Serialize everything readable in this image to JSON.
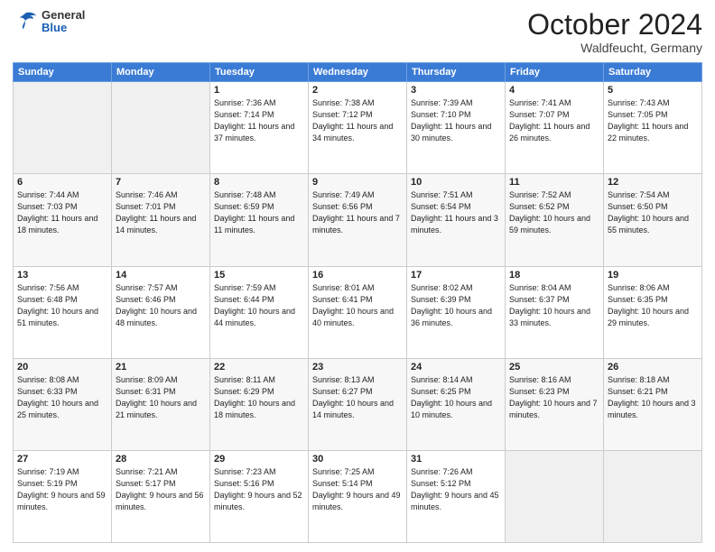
{
  "header": {
    "logo_general": "General",
    "logo_blue": "Blue",
    "title": "October 2024",
    "location": "Waldfeucht, Germany"
  },
  "days_of_week": [
    "Sunday",
    "Monday",
    "Tuesday",
    "Wednesday",
    "Thursday",
    "Friday",
    "Saturday"
  ],
  "weeks": [
    {
      "days": [
        {
          "num": "",
          "info": ""
        },
        {
          "num": "",
          "info": ""
        },
        {
          "num": "1",
          "info": "Sunrise: 7:36 AM\nSunset: 7:14 PM\nDaylight: 11 hours and 37 minutes."
        },
        {
          "num": "2",
          "info": "Sunrise: 7:38 AM\nSunset: 7:12 PM\nDaylight: 11 hours and 34 minutes."
        },
        {
          "num": "3",
          "info": "Sunrise: 7:39 AM\nSunset: 7:10 PM\nDaylight: 11 hours and 30 minutes."
        },
        {
          "num": "4",
          "info": "Sunrise: 7:41 AM\nSunset: 7:07 PM\nDaylight: 11 hours and 26 minutes."
        },
        {
          "num": "5",
          "info": "Sunrise: 7:43 AM\nSunset: 7:05 PM\nDaylight: 11 hours and 22 minutes."
        }
      ]
    },
    {
      "days": [
        {
          "num": "6",
          "info": "Sunrise: 7:44 AM\nSunset: 7:03 PM\nDaylight: 11 hours and 18 minutes."
        },
        {
          "num": "7",
          "info": "Sunrise: 7:46 AM\nSunset: 7:01 PM\nDaylight: 11 hours and 14 minutes."
        },
        {
          "num": "8",
          "info": "Sunrise: 7:48 AM\nSunset: 6:59 PM\nDaylight: 11 hours and 11 minutes."
        },
        {
          "num": "9",
          "info": "Sunrise: 7:49 AM\nSunset: 6:56 PM\nDaylight: 11 hours and 7 minutes."
        },
        {
          "num": "10",
          "info": "Sunrise: 7:51 AM\nSunset: 6:54 PM\nDaylight: 11 hours and 3 minutes."
        },
        {
          "num": "11",
          "info": "Sunrise: 7:52 AM\nSunset: 6:52 PM\nDaylight: 10 hours and 59 minutes."
        },
        {
          "num": "12",
          "info": "Sunrise: 7:54 AM\nSunset: 6:50 PM\nDaylight: 10 hours and 55 minutes."
        }
      ]
    },
    {
      "days": [
        {
          "num": "13",
          "info": "Sunrise: 7:56 AM\nSunset: 6:48 PM\nDaylight: 10 hours and 51 minutes."
        },
        {
          "num": "14",
          "info": "Sunrise: 7:57 AM\nSunset: 6:46 PM\nDaylight: 10 hours and 48 minutes."
        },
        {
          "num": "15",
          "info": "Sunrise: 7:59 AM\nSunset: 6:44 PM\nDaylight: 10 hours and 44 minutes."
        },
        {
          "num": "16",
          "info": "Sunrise: 8:01 AM\nSunset: 6:41 PM\nDaylight: 10 hours and 40 minutes."
        },
        {
          "num": "17",
          "info": "Sunrise: 8:02 AM\nSunset: 6:39 PM\nDaylight: 10 hours and 36 minutes."
        },
        {
          "num": "18",
          "info": "Sunrise: 8:04 AM\nSunset: 6:37 PM\nDaylight: 10 hours and 33 minutes."
        },
        {
          "num": "19",
          "info": "Sunrise: 8:06 AM\nSunset: 6:35 PM\nDaylight: 10 hours and 29 minutes."
        }
      ]
    },
    {
      "days": [
        {
          "num": "20",
          "info": "Sunrise: 8:08 AM\nSunset: 6:33 PM\nDaylight: 10 hours and 25 minutes."
        },
        {
          "num": "21",
          "info": "Sunrise: 8:09 AM\nSunset: 6:31 PM\nDaylight: 10 hours and 21 minutes."
        },
        {
          "num": "22",
          "info": "Sunrise: 8:11 AM\nSunset: 6:29 PM\nDaylight: 10 hours and 18 minutes."
        },
        {
          "num": "23",
          "info": "Sunrise: 8:13 AM\nSunset: 6:27 PM\nDaylight: 10 hours and 14 minutes."
        },
        {
          "num": "24",
          "info": "Sunrise: 8:14 AM\nSunset: 6:25 PM\nDaylight: 10 hours and 10 minutes."
        },
        {
          "num": "25",
          "info": "Sunrise: 8:16 AM\nSunset: 6:23 PM\nDaylight: 10 hours and 7 minutes."
        },
        {
          "num": "26",
          "info": "Sunrise: 8:18 AM\nSunset: 6:21 PM\nDaylight: 10 hours and 3 minutes."
        }
      ]
    },
    {
      "days": [
        {
          "num": "27",
          "info": "Sunrise: 7:19 AM\nSunset: 5:19 PM\nDaylight: 9 hours and 59 minutes."
        },
        {
          "num": "28",
          "info": "Sunrise: 7:21 AM\nSunset: 5:17 PM\nDaylight: 9 hours and 56 minutes."
        },
        {
          "num": "29",
          "info": "Sunrise: 7:23 AM\nSunset: 5:16 PM\nDaylight: 9 hours and 52 minutes."
        },
        {
          "num": "30",
          "info": "Sunrise: 7:25 AM\nSunset: 5:14 PM\nDaylight: 9 hours and 49 minutes."
        },
        {
          "num": "31",
          "info": "Sunrise: 7:26 AM\nSunset: 5:12 PM\nDaylight: 9 hours and 45 minutes."
        },
        {
          "num": "",
          "info": ""
        },
        {
          "num": "",
          "info": ""
        }
      ]
    }
  ]
}
